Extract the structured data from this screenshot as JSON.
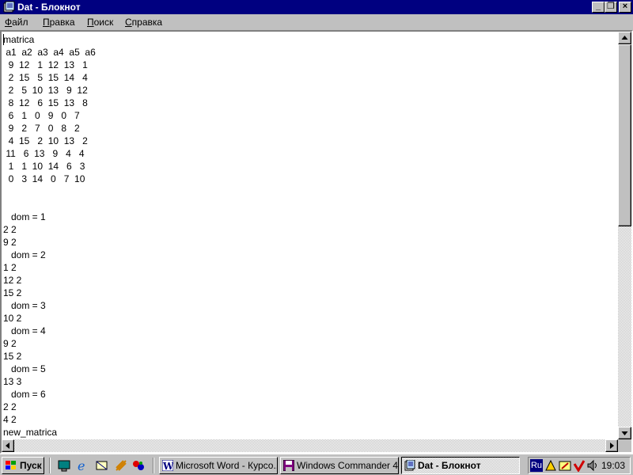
{
  "window": {
    "title": "Dat - Блокнот",
    "minimize_glyph": "_",
    "maximize_glyph": "❐",
    "close_glyph": "×"
  },
  "menu": {
    "items": [
      {
        "first": "Ф",
        "rest": "айл"
      },
      {
        "first": "П",
        "rest": "равка"
      },
      {
        "first": "П",
        "rest": "оиск"
      },
      {
        "first": "С",
        "rest": "правка"
      }
    ]
  },
  "document": {
    "text": "matrica\n a1  a2  a3  a4  a5  a6\n  9  12   1  12  13   1\n  2  15   5  15  14   4\n  2   5  10  13   9  12\n  8  12   6  15  13   8\n  6   1   0   9   0   7\n  9   2   7   0   8   2\n  4  15   2  10  13   2\n 11   6  13   9   4   4\n  1   1  10  14   6   3\n  0   3  14   0   7  10\n\n\n   dom = 1\n2 2\n9 2\n   dom = 2\n1 2\n12 2\n15 2\n   dom = 3\n10 2\n   dom = 4\n9 2\n15 2\n   dom = 5\n13 3\n   dom = 6\n2 2\n4 2\nnew_matrica"
  },
  "taskbar": {
    "start_label": "Пуск",
    "tasks": [
      {
        "label": "Microsoft Word - Курсо...",
        "icon": "word-icon"
      },
      {
        "label": "Windows Commander 4....",
        "icon": "floppy-icon"
      },
      {
        "label": "Dat - Блокнот",
        "icon": "notepad-icon",
        "active": true
      }
    ],
    "tray": {
      "lang": "Ru",
      "clock": "19:03"
    }
  }
}
